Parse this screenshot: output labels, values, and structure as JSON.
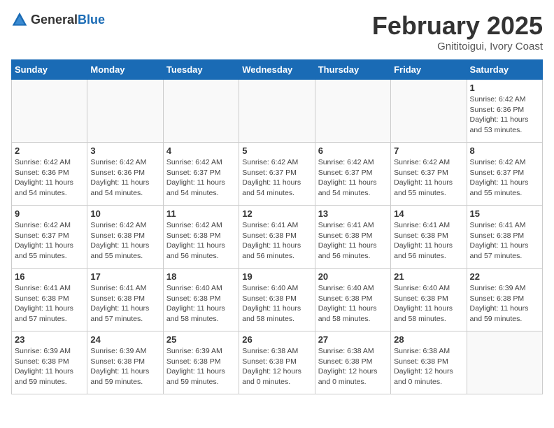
{
  "header": {
    "logo_general": "General",
    "logo_blue": "Blue",
    "main_title": "February 2025",
    "sub_title": "Gnititoigui, Ivory Coast"
  },
  "days_of_week": [
    "Sunday",
    "Monday",
    "Tuesday",
    "Wednesday",
    "Thursday",
    "Friday",
    "Saturday"
  ],
  "weeks": [
    [
      {
        "day": "",
        "info": ""
      },
      {
        "day": "",
        "info": ""
      },
      {
        "day": "",
        "info": ""
      },
      {
        "day": "",
        "info": ""
      },
      {
        "day": "",
        "info": ""
      },
      {
        "day": "",
        "info": ""
      },
      {
        "day": "1",
        "info": "Sunrise: 6:42 AM\nSunset: 6:36 PM\nDaylight: 11 hours and 53 minutes."
      }
    ],
    [
      {
        "day": "2",
        "info": "Sunrise: 6:42 AM\nSunset: 6:36 PM\nDaylight: 11 hours and 54 minutes."
      },
      {
        "day": "3",
        "info": "Sunrise: 6:42 AM\nSunset: 6:36 PM\nDaylight: 11 hours and 54 minutes."
      },
      {
        "day": "4",
        "info": "Sunrise: 6:42 AM\nSunset: 6:37 PM\nDaylight: 11 hours and 54 minutes."
      },
      {
        "day": "5",
        "info": "Sunrise: 6:42 AM\nSunset: 6:37 PM\nDaylight: 11 hours and 54 minutes."
      },
      {
        "day": "6",
        "info": "Sunrise: 6:42 AM\nSunset: 6:37 PM\nDaylight: 11 hours and 54 minutes."
      },
      {
        "day": "7",
        "info": "Sunrise: 6:42 AM\nSunset: 6:37 PM\nDaylight: 11 hours and 55 minutes."
      },
      {
        "day": "8",
        "info": "Sunrise: 6:42 AM\nSunset: 6:37 PM\nDaylight: 11 hours and 55 minutes."
      }
    ],
    [
      {
        "day": "9",
        "info": "Sunrise: 6:42 AM\nSunset: 6:37 PM\nDaylight: 11 hours and 55 minutes."
      },
      {
        "day": "10",
        "info": "Sunrise: 6:42 AM\nSunset: 6:38 PM\nDaylight: 11 hours and 55 minutes."
      },
      {
        "day": "11",
        "info": "Sunrise: 6:42 AM\nSunset: 6:38 PM\nDaylight: 11 hours and 56 minutes."
      },
      {
        "day": "12",
        "info": "Sunrise: 6:41 AM\nSunset: 6:38 PM\nDaylight: 11 hours and 56 minutes."
      },
      {
        "day": "13",
        "info": "Sunrise: 6:41 AM\nSunset: 6:38 PM\nDaylight: 11 hours and 56 minutes."
      },
      {
        "day": "14",
        "info": "Sunrise: 6:41 AM\nSunset: 6:38 PM\nDaylight: 11 hours and 56 minutes."
      },
      {
        "day": "15",
        "info": "Sunrise: 6:41 AM\nSunset: 6:38 PM\nDaylight: 11 hours and 57 minutes."
      }
    ],
    [
      {
        "day": "16",
        "info": "Sunrise: 6:41 AM\nSunset: 6:38 PM\nDaylight: 11 hours and 57 minutes."
      },
      {
        "day": "17",
        "info": "Sunrise: 6:41 AM\nSunset: 6:38 PM\nDaylight: 11 hours and 57 minutes."
      },
      {
        "day": "18",
        "info": "Sunrise: 6:40 AM\nSunset: 6:38 PM\nDaylight: 11 hours and 58 minutes."
      },
      {
        "day": "19",
        "info": "Sunrise: 6:40 AM\nSunset: 6:38 PM\nDaylight: 11 hours and 58 minutes."
      },
      {
        "day": "20",
        "info": "Sunrise: 6:40 AM\nSunset: 6:38 PM\nDaylight: 11 hours and 58 minutes."
      },
      {
        "day": "21",
        "info": "Sunrise: 6:40 AM\nSunset: 6:38 PM\nDaylight: 11 hours and 58 minutes."
      },
      {
        "day": "22",
        "info": "Sunrise: 6:39 AM\nSunset: 6:38 PM\nDaylight: 11 hours and 59 minutes."
      }
    ],
    [
      {
        "day": "23",
        "info": "Sunrise: 6:39 AM\nSunset: 6:38 PM\nDaylight: 11 hours and 59 minutes."
      },
      {
        "day": "24",
        "info": "Sunrise: 6:39 AM\nSunset: 6:38 PM\nDaylight: 11 hours and 59 minutes."
      },
      {
        "day": "25",
        "info": "Sunrise: 6:39 AM\nSunset: 6:38 PM\nDaylight: 11 hours and 59 minutes."
      },
      {
        "day": "26",
        "info": "Sunrise: 6:38 AM\nSunset: 6:38 PM\nDaylight: 12 hours and 0 minutes."
      },
      {
        "day": "27",
        "info": "Sunrise: 6:38 AM\nSunset: 6:38 PM\nDaylight: 12 hours and 0 minutes."
      },
      {
        "day": "28",
        "info": "Sunrise: 6:38 AM\nSunset: 6:38 PM\nDaylight: 12 hours and 0 minutes."
      },
      {
        "day": "",
        "info": ""
      }
    ]
  ]
}
